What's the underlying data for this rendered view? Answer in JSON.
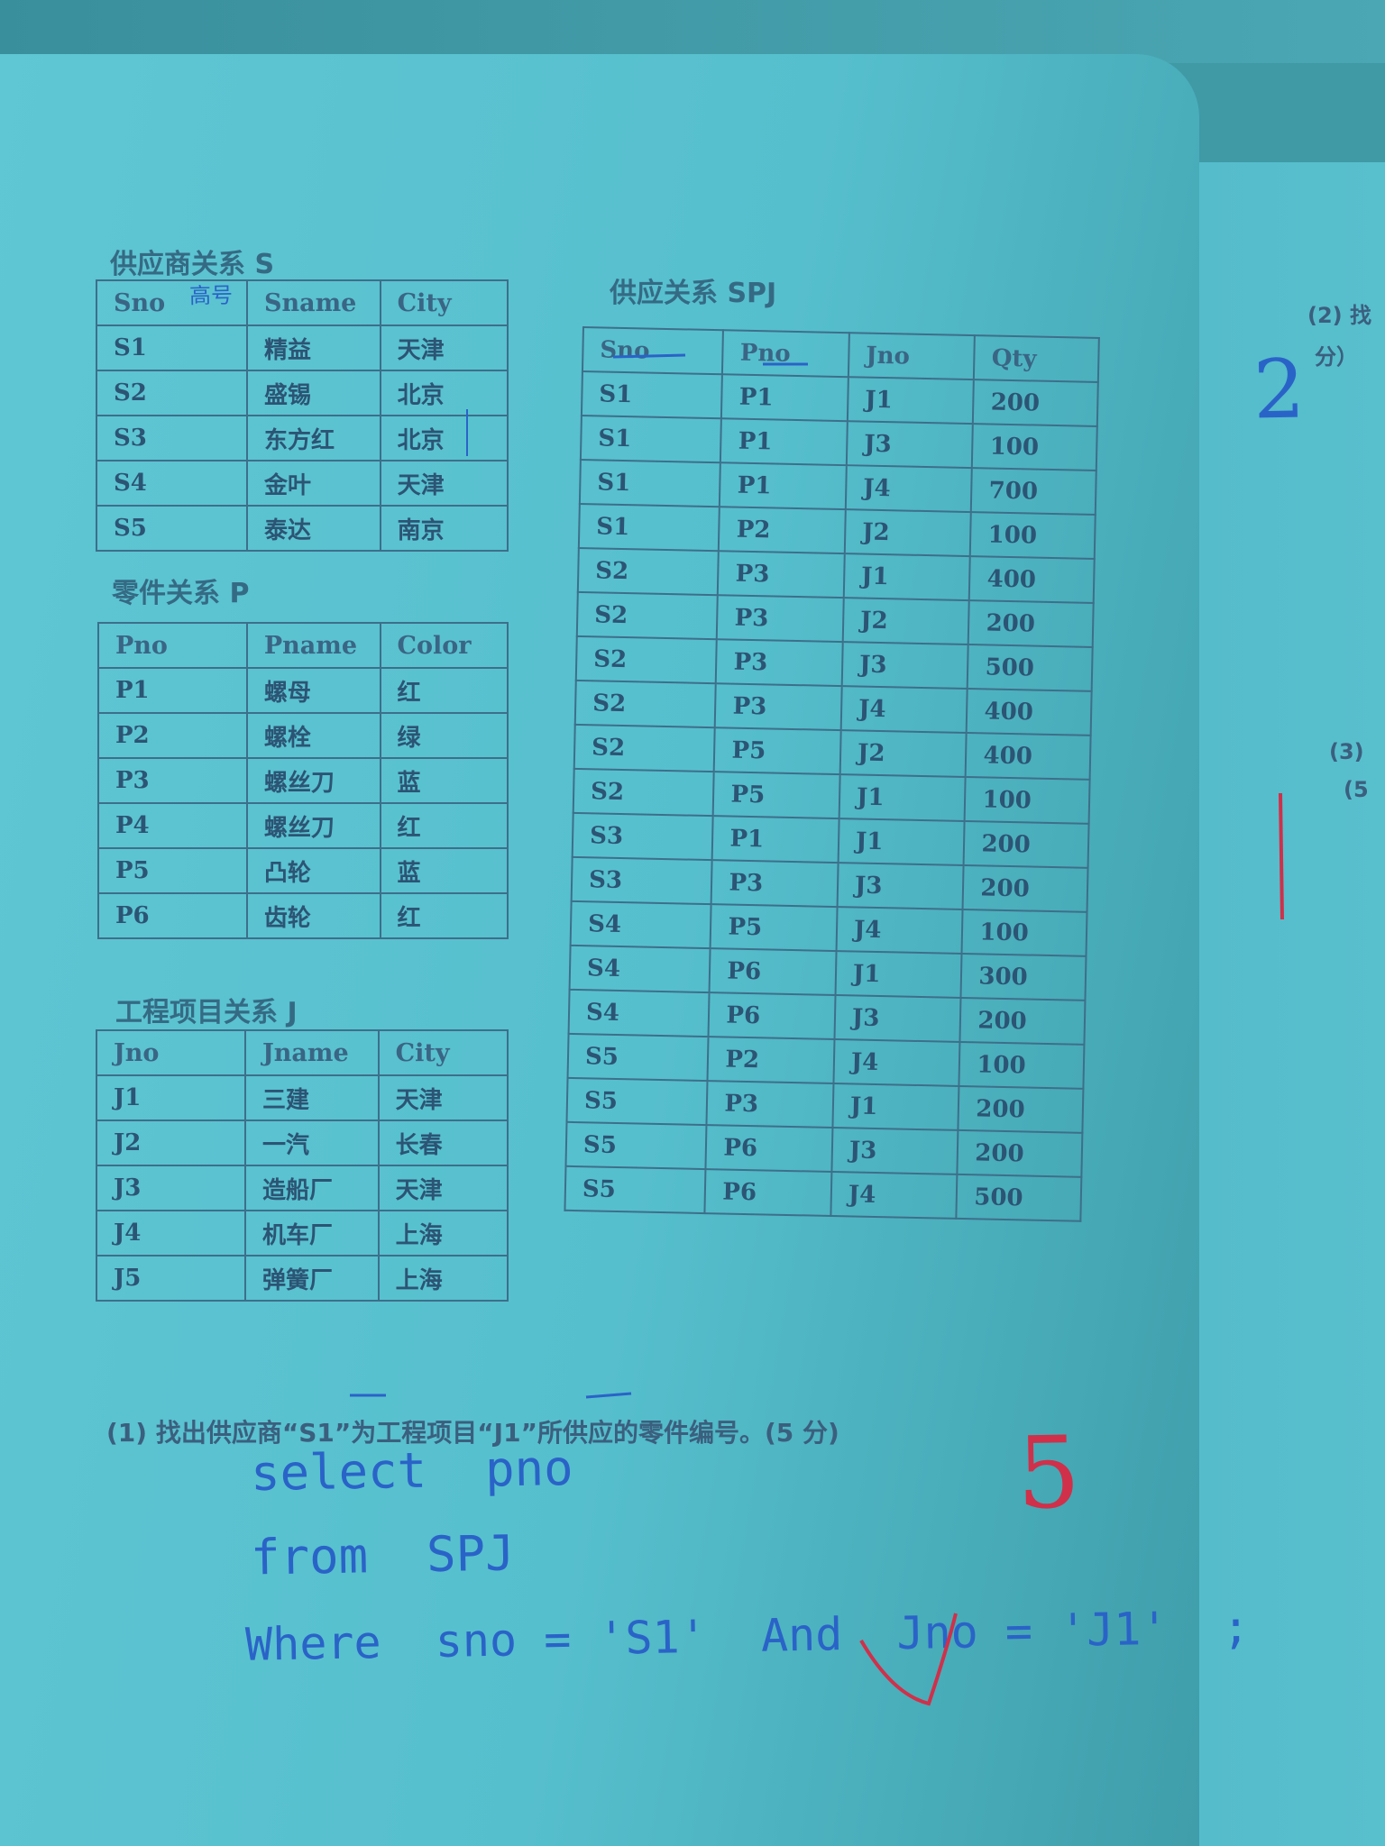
{
  "supplier_table": {
    "caption": "供应商关系 S",
    "headers": [
      "Sno",
      "Sname",
      "City"
    ],
    "rows": [
      [
        "S1",
        "精益",
        "天津"
      ],
      [
        "S2",
        "盛锡",
        "北京"
      ],
      [
        "S3",
        "东方红",
        "北京"
      ],
      [
        "S4",
        "金叶",
        "天津"
      ],
      [
        "S5",
        "泰达",
        "南京"
      ]
    ]
  },
  "part_table": {
    "caption": "零件关系 P",
    "headers": [
      "Pno",
      "Pname",
      "Color"
    ],
    "rows": [
      [
        "P1",
        "螺母",
        "红"
      ],
      [
        "P2",
        "螺栓",
        "绿"
      ],
      [
        "P3",
        "螺丝刀",
        "蓝"
      ],
      [
        "P4",
        "螺丝刀",
        "红"
      ],
      [
        "P5",
        "凸轮",
        "蓝"
      ],
      [
        "P6",
        "齿轮",
        "红"
      ]
    ]
  },
  "project_table": {
    "caption": "工程项目关系 J",
    "headers": [
      "Jno",
      "Jname",
      "City"
    ],
    "rows": [
      [
        "J1",
        "三建",
        "天津"
      ],
      [
        "J2",
        "一汽",
        "长春"
      ],
      [
        "J3",
        "造船厂",
        "天津"
      ],
      [
        "J4",
        "机车厂",
        "上海"
      ],
      [
        "J5",
        "弹簧厂",
        "上海"
      ]
    ]
  },
  "spj_table": {
    "caption": "供应关系 SPJ",
    "headers": [
      "Sno",
      "Pno",
      "Jno",
      "Qty"
    ],
    "rows": [
      [
        "S1",
        "P1",
        "J1",
        "200"
      ],
      [
        "S1",
        "P1",
        "J3",
        "100"
      ],
      [
        "S1",
        "P1",
        "J4",
        "700"
      ],
      [
        "S1",
        "P2",
        "J2",
        "100"
      ],
      [
        "S2",
        "P3",
        "J1",
        "400"
      ],
      [
        "S2",
        "P3",
        "J2",
        "200"
      ],
      [
        "S2",
        "P3",
        "J3",
        "500"
      ],
      [
        "S2",
        "P3",
        "J4",
        "400"
      ],
      [
        "S2",
        "P5",
        "J2",
        "400"
      ],
      [
        "S2",
        "P5",
        "J1",
        "100"
      ],
      [
        "S3",
        "P1",
        "J1",
        "200"
      ],
      [
        "S3",
        "P3",
        "J3",
        "200"
      ],
      [
        "S4",
        "P5",
        "J4",
        "100"
      ],
      [
        "S4",
        "P6",
        "J1",
        "300"
      ],
      [
        "S4",
        "P6",
        "J3",
        "200"
      ],
      [
        "S5",
        "P2",
        "J4",
        "100"
      ],
      [
        "S5",
        "P3",
        "J1",
        "200"
      ],
      [
        "S5",
        "P6",
        "J3",
        "200"
      ],
      [
        "S5",
        "P6",
        "J4",
        "500"
      ]
    ]
  },
  "question1": "(1) 找出供应商“S1”为工程项目“J1”所供应的零件编号。(5 分)",
  "handwritten_answer": {
    "line1": "select  pno",
    "line2": "from  SPJ",
    "line3": "Where  sno = 'S1'  And  Jno = 'J1'  ;"
  },
  "grade_mark_q1": "5",
  "grade_mark_q2": "2",
  "handwritten_note_sno": "高号",
  "margin_right": {
    "q2_label": "(2) 找",
    "q2_fen": "分）",
    "q3_label": "(3)",
    "q3_sub": "(5"
  },
  "colors": {
    "page": "#5fc6d3",
    "ink_print": "#2c5474",
    "ink_pen_blue": "#2a63c8",
    "ink_pen_red": "#d0304a"
  }
}
